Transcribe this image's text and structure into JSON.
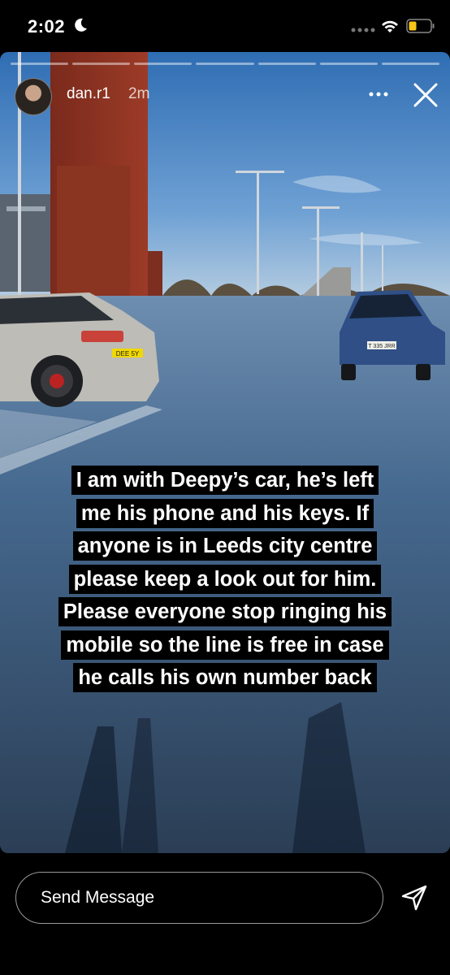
{
  "status_bar": {
    "time": "2:02",
    "icons": [
      "moon-icon",
      "cellular-signal-icon",
      "wifi-icon",
      "battery-icon"
    ]
  },
  "story": {
    "username": "dan.r1",
    "time_ago": "2m",
    "segments": 7,
    "caption_lines": [
      "I am with Deepy’s car, he’s left",
      "me his phone and his keys. If",
      "anyone is in Leeds city centre",
      "please keep a look out for him.",
      "Please everyone stop ringing his",
      "mobile so the line is free in case",
      "he calls his own number back"
    ],
    "plates": [
      "DEE 5Y",
      "T 335 JRR"
    ]
  },
  "message": {
    "placeholder": "Send Message"
  },
  "colors": {
    "background": "#000000",
    "battery": "#f5c518",
    "caption_bg": "#000000"
  }
}
